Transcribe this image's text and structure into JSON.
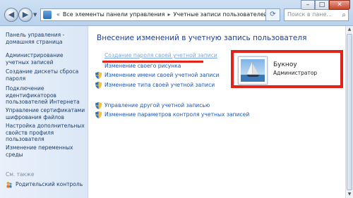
{
  "address": {
    "crumbs": [
      "Все элементы панели управления",
      "Учетные записи пользователей"
    ],
    "search_placeholder": "Поиск в пане..."
  },
  "left_pane": {
    "home": "Панель управления - домашняя страница",
    "items": [
      "Администрирование учетных записей",
      "Создание дискеты сброса пароля",
      "Подключение идентификаторов пользователей Интернета",
      "Управление сертификатами шифрования файлов",
      "Настройка дополнительных свойств профиля пользователя",
      "Изменение переменных среды"
    ],
    "see_also": "См. также",
    "parental_control": "Родительский контроль"
  },
  "main": {
    "title": "Внесение изменений в учетную запись пользователя",
    "links": {
      "create_password": "Создание пароля своей учетной записи",
      "change_picture": "Изменение своего рисунка",
      "change_name": "Изменение имени своей учетной записи",
      "change_type": "Изменение типа своей учетной записи",
      "manage_other": "Управление другой учетной записью",
      "uac_settings": "Изменение параметров контроля учетных записей"
    }
  },
  "user": {
    "name": "Букноу",
    "role": "Администратор"
  },
  "colors": {
    "highlight": "#e2231a",
    "link": "#1c57b6",
    "title": "#1c3f94"
  },
  "icons": [
    "back-arrow-icon",
    "forward-arrow-icon",
    "control-panel-icon",
    "refresh-icon",
    "search-icon",
    "shield-icon",
    "parental-control-icon"
  ]
}
